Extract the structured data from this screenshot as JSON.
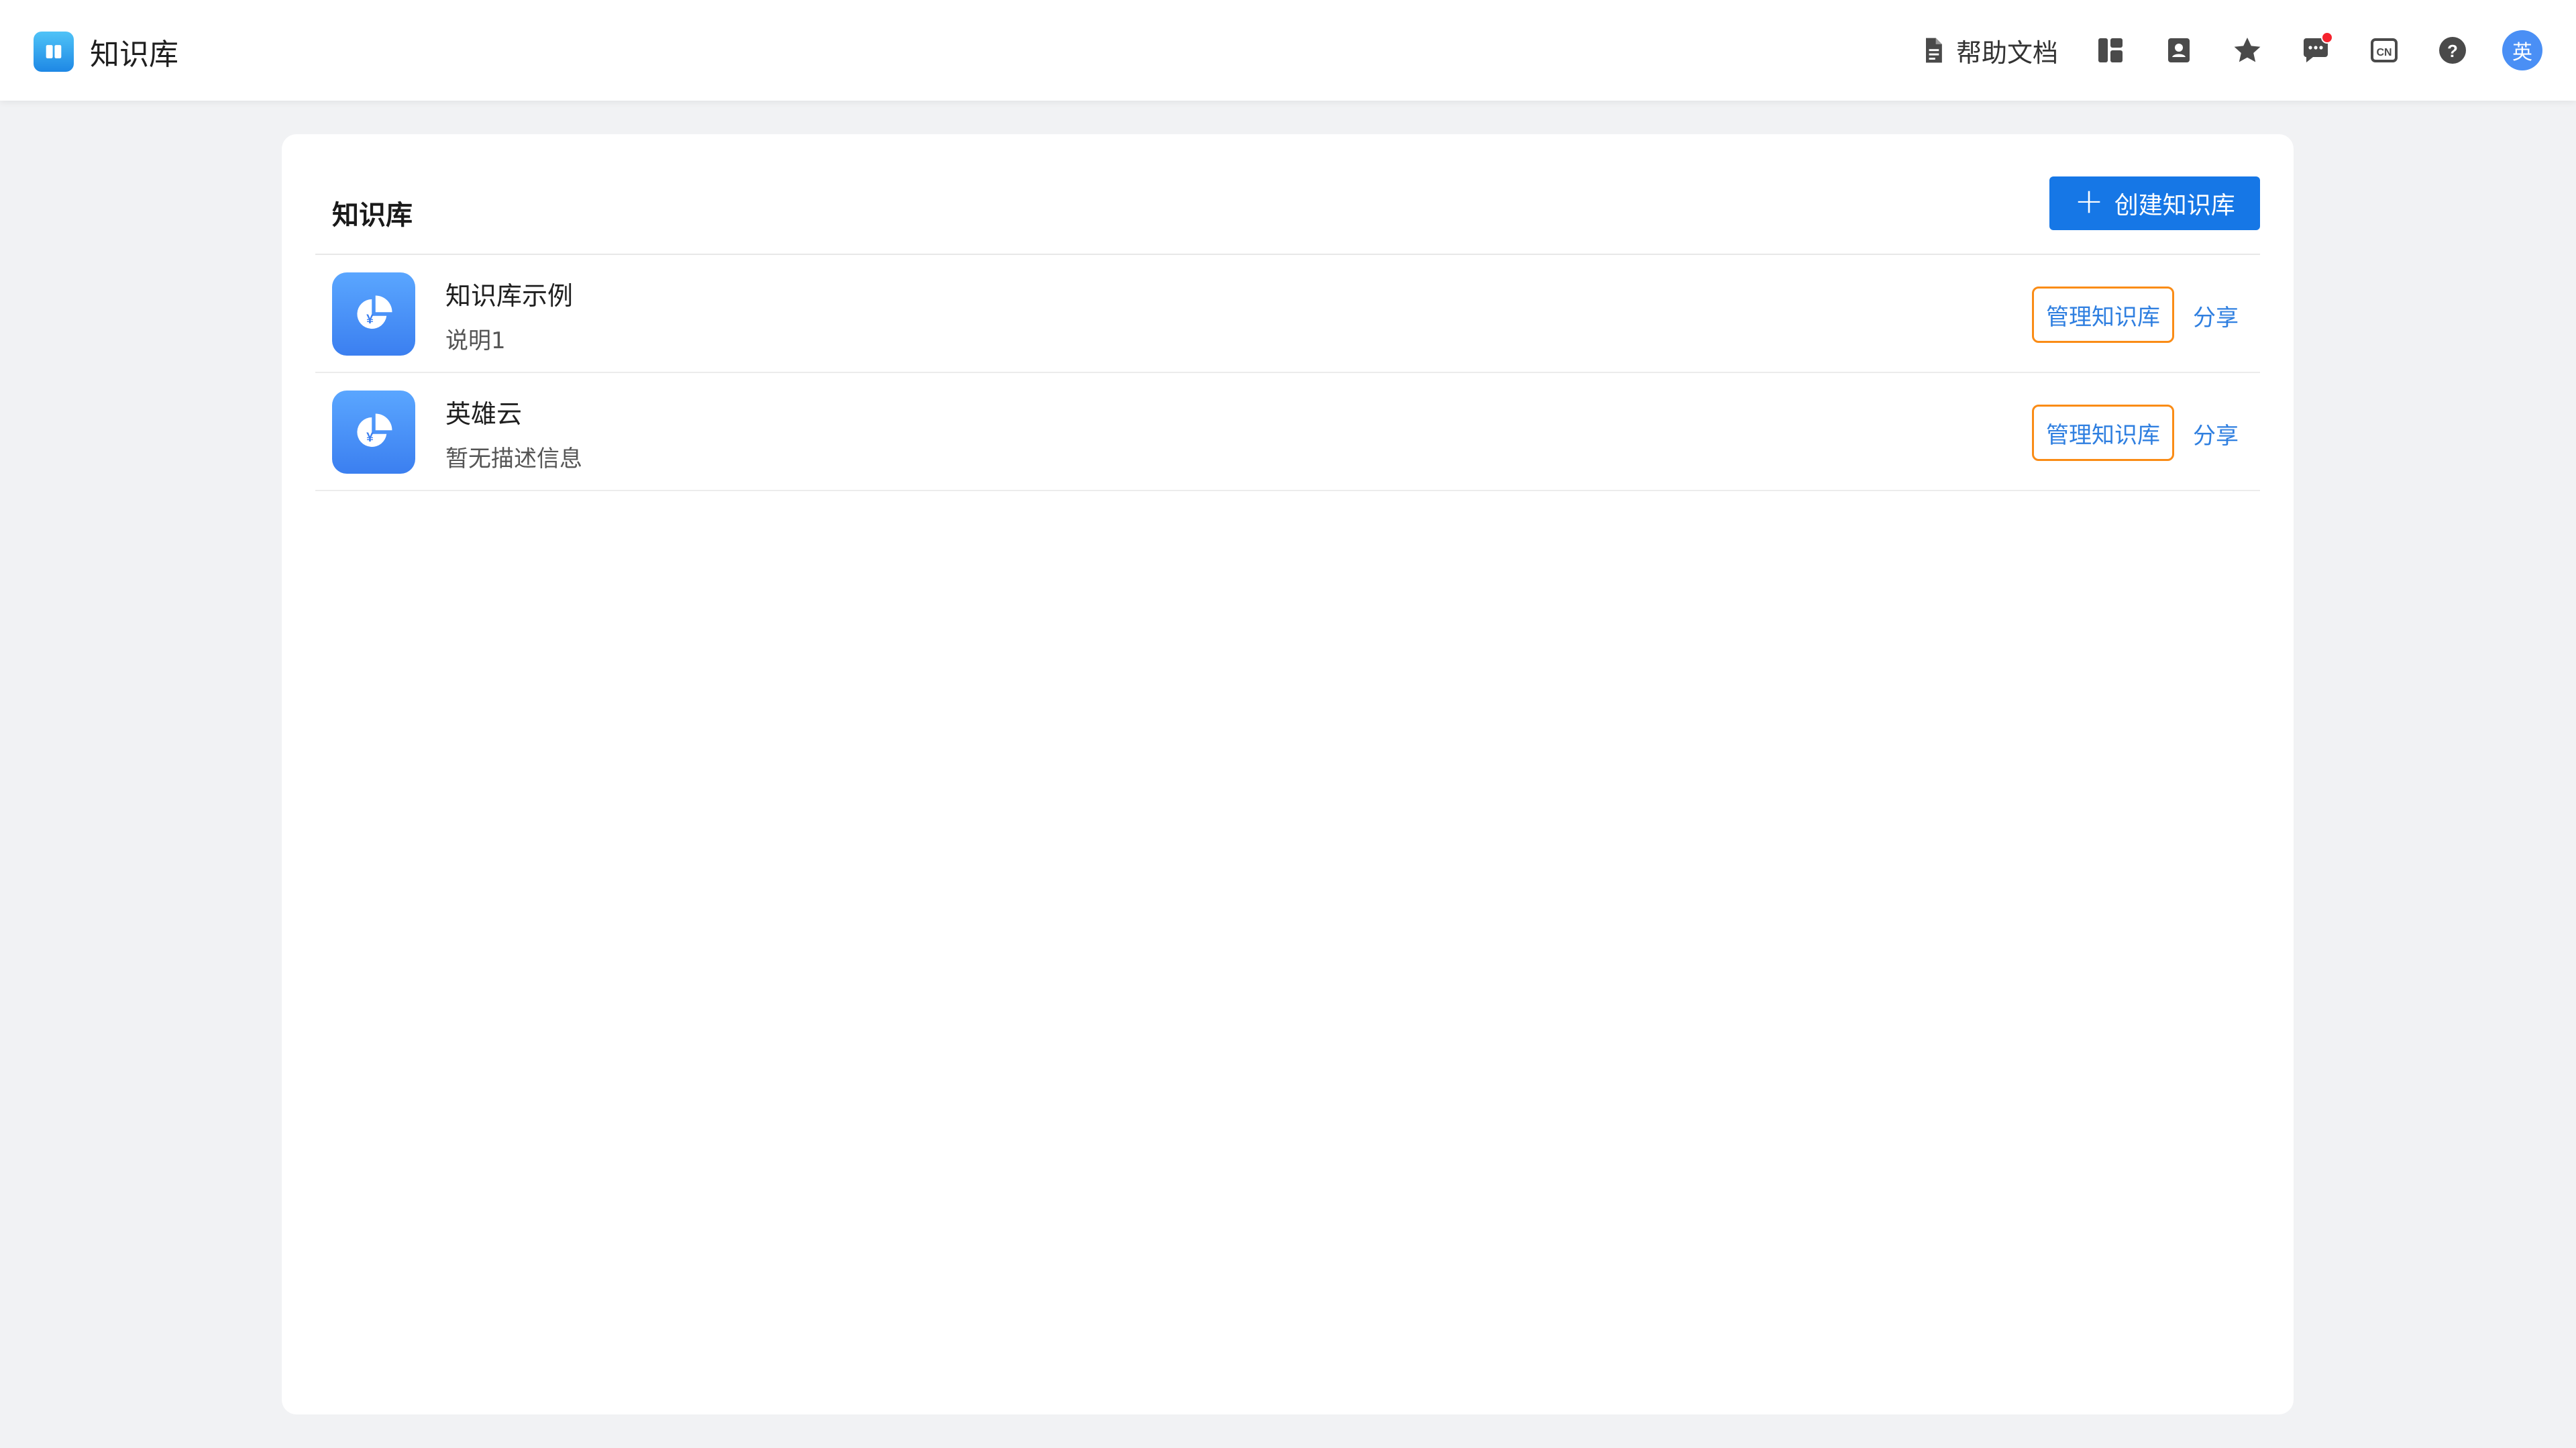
{
  "header": {
    "title": "知识库",
    "help_doc_label": "帮助文档",
    "avatar_text": "英",
    "has_notification": true,
    "icons": [
      "document-icon",
      "layout-icon",
      "contacts-icon",
      "star-icon",
      "message-icon",
      "language-cn-icon",
      "help-icon"
    ]
  },
  "main": {
    "title": "知识库",
    "create_label": "创建知识库",
    "items": [
      {
        "name": "知识库示例",
        "description": "说明1",
        "manage_label": "管理知识库",
        "share_label": "分享"
      },
      {
        "name": "英雄云",
        "description": "暂无描述信息",
        "manage_label": "管理知识库",
        "share_label": "分享"
      }
    ]
  },
  "colors": {
    "primary": "#1677e6",
    "manage_border": "#fa8c16",
    "link": "#2f7fe0",
    "avatar": "#4a8ff5",
    "background": "#f1f2f4"
  }
}
